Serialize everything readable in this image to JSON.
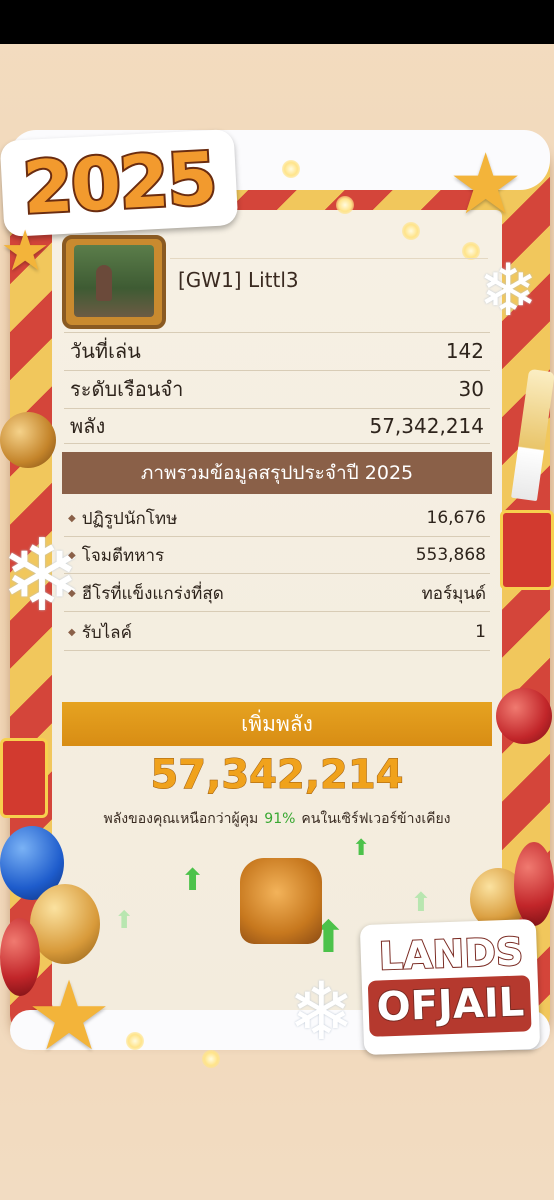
{
  "logo_year": "2025",
  "player": {
    "name": "[GW1]  Littl3"
  },
  "info": [
    {
      "label": "วันที่เล่น",
      "value": "142"
    },
    {
      "label": "ระดับเรือนจำ",
      "value": "30"
    },
    {
      "label": "พลัง",
      "value": "57,342,214"
    }
  ],
  "summary": {
    "title": "ภาพรวมข้อมูลสรุปประจำปี  2025",
    "rows": [
      {
        "label": "ปฏิรูปนักโทษ",
        "value": "16,676"
      },
      {
        "label": "โจมตีทหาร",
        "value": "553,868"
      },
      {
        "label": "ฮีโรที่แข็งแกร่งที่สุด",
        "value": "ทอร์มุนด์"
      },
      {
        "label": "รับไลค์",
        "value": "1"
      }
    ]
  },
  "power": {
    "title": "เพิ่มพลัง",
    "value": "57,342,214",
    "compare_before": "พลังของคุณเหนือกว่าผู้คุม",
    "compare_pct": "91%",
    "compare_after": "คนในเซิร์ฟเวอร์ข้างเคียง"
  },
  "game_logo": {
    "line1": "LANDS",
    "line2": "OFJAIL"
  },
  "colors": {
    "stripe_red": "#d4453a",
    "stripe_gold": "#f1c75c",
    "header_brown": "#8a6048",
    "power_orange": "#e6a321",
    "pct_green": "#39a832"
  },
  "icons": [
    "star-icon",
    "snowflake-icon",
    "arrow-up-icon",
    "fist-icon",
    "ornament-icon",
    "gift-icon",
    "champagne-icon",
    "balloon-icon"
  ]
}
